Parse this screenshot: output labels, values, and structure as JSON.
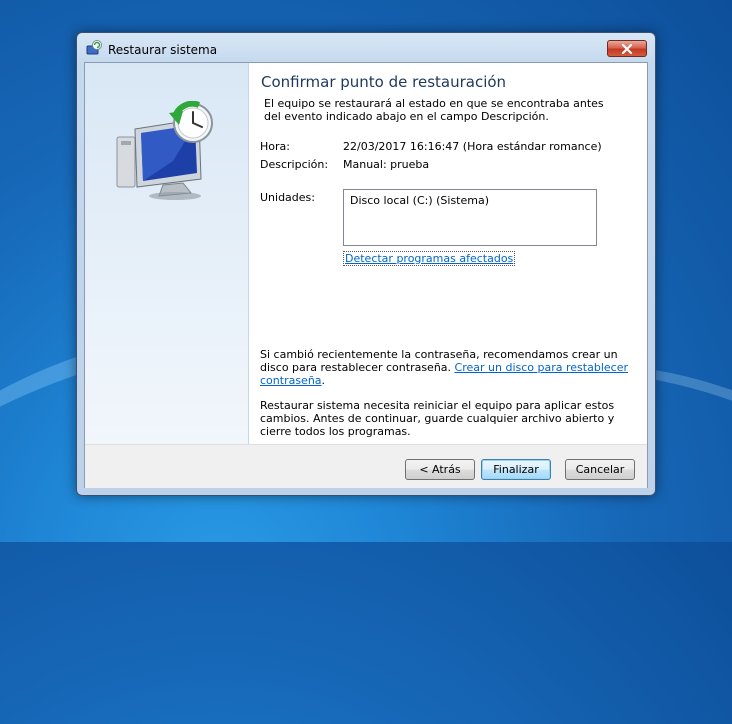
{
  "window": {
    "title": "Restaurar sistema"
  },
  "content": {
    "heading": "Confirmar punto de restauración",
    "intro": "El equipo se restaurará al estado en que se encontraba antes del evento indicado abajo en el campo Descripción.",
    "time_label": "Hora:",
    "time_value": "22/03/2017 16:16:47 (Hora estándar romance)",
    "description_label": "Descripción:",
    "description_value": "Manual: prueba",
    "drives_label": "Unidades:",
    "drives": [
      "Disco local (C:) (Sistema)"
    ],
    "detect_link": "Detectar programas afectados",
    "password_text": "Si cambió recientemente la contraseña, recomendamos crear un disco para restablecer contraseña.",
    "password_link": "Crear un disco para restablecer contraseña",
    "password_end": ".",
    "restart_text": "Restaurar sistema necesita reiniciar el equipo para aplicar estos cambios. Antes de continuar, guarde cualquier archivo abierto y cierre todos los programas."
  },
  "footer": {
    "back_label": "< Atrás",
    "finish_label": "Finalizar",
    "cancel_label": "Cancelar"
  },
  "colors": {
    "heading": "#1e395b",
    "link": "#0066cc",
    "desktop": "#1768b8"
  },
  "icons": {
    "title": "system-restore-icon",
    "hero": "system-restore-monitor-clock-icon",
    "close": "close-icon"
  }
}
